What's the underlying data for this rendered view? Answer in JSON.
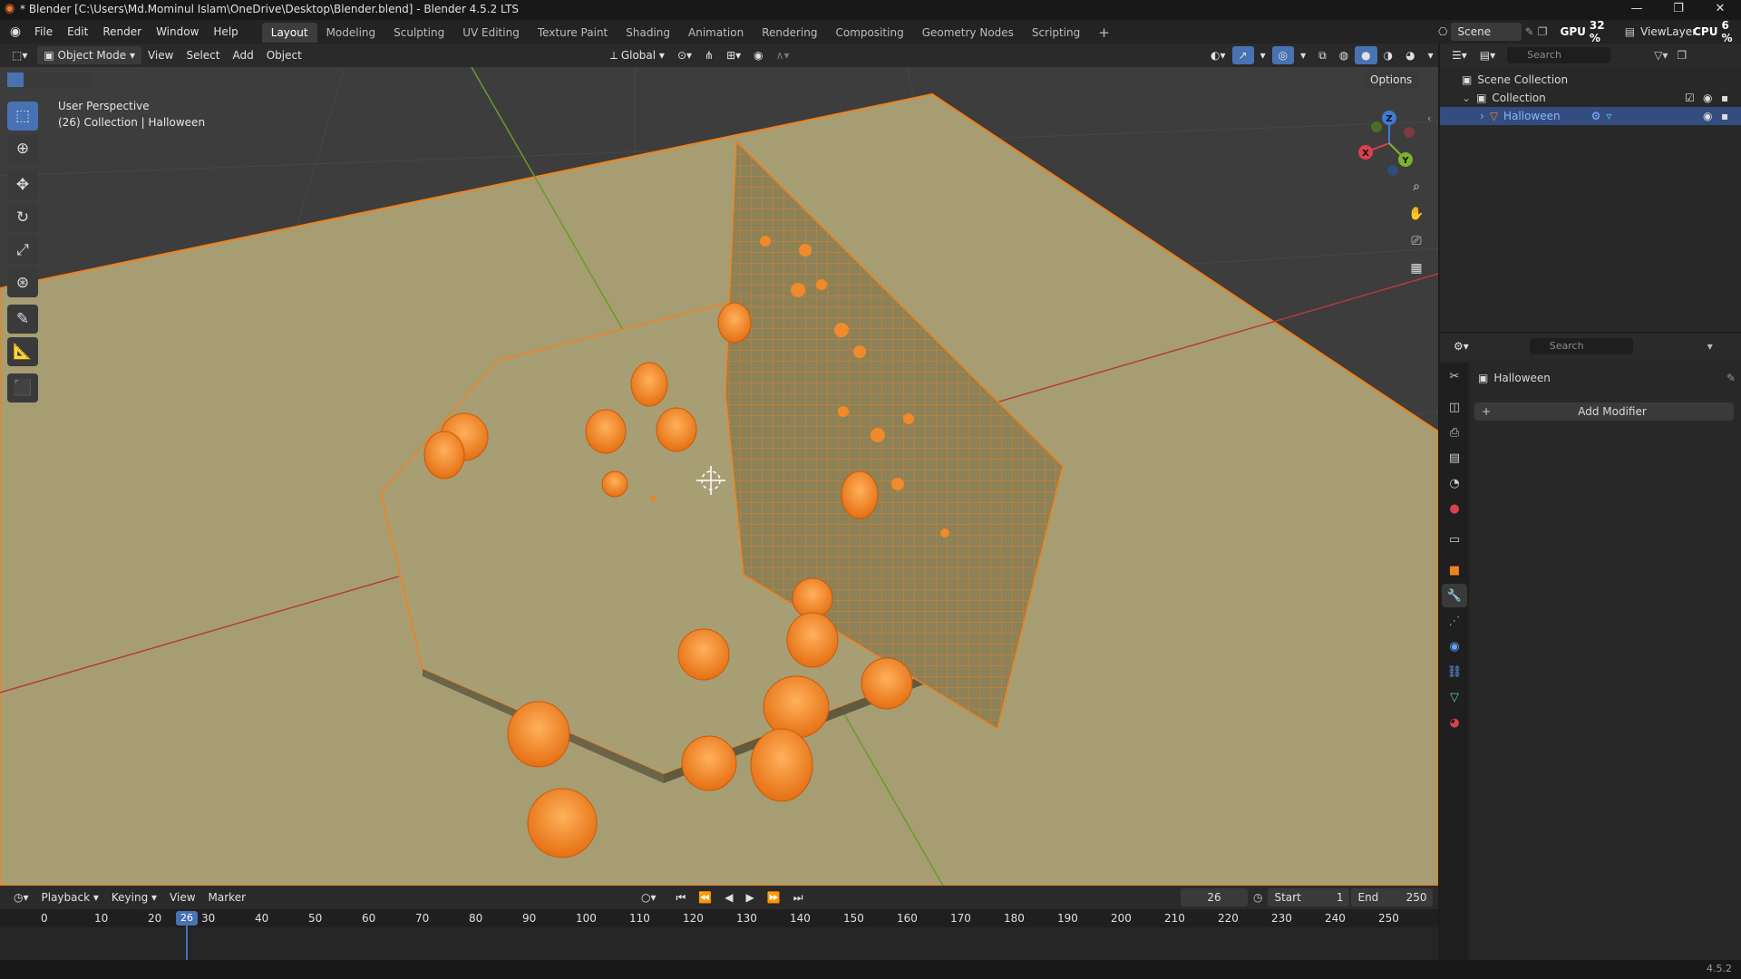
{
  "window": {
    "title": "* Blender [C:\\Users\\Md.Mominul Islam\\OneDrive\\Desktop\\Blender.blend] - Blender 4.5.2 LTS",
    "minimize": "—",
    "maximize": "❐",
    "close": "✕"
  },
  "menu": {
    "items": [
      "File",
      "Edit",
      "Render",
      "Window",
      "Help"
    ],
    "workspaces": [
      "Layout",
      "Modeling",
      "Sculpting",
      "UV Editing",
      "Texture Paint",
      "Shading",
      "Animation",
      "Rendering",
      "Compositing",
      "Geometry Nodes",
      "Scripting"
    ],
    "active_workspace": "Layout",
    "add_tab": "+",
    "scene_label": "Scene",
    "viewlayer_label": "ViewLayer",
    "gpu_label": "GPU",
    "gpu_value": "32 %",
    "cpu_label": "CPU",
    "cpu_value": "6 %"
  },
  "viewport_header": {
    "mode": "Object Mode",
    "menus": [
      "View",
      "Select",
      "Add",
      "Object"
    ],
    "transform_orientation": "Global",
    "options": "Options"
  },
  "viewport": {
    "perspective": "User Perspective",
    "collection_info": "(26) Collection | Halloween",
    "axes": {
      "x": "X",
      "y": "Y",
      "z": "Z"
    },
    "colors": {
      "background": "#3d3d3d",
      "plane": "#a79d73",
      "selection": "#f0821e",
      "x_axis": "#b53a3f",
      "y_axis": "#6b9a2a",
      "grid": "#4a4a4a"
    }
  },
  "timeline": {
    "menus": [
      "Playback",
      "Keying",
      "View",
      "Marker"
    ],
    "current_frame": "26",
    "start_label": "Start",
    "start_value": "1",
    "end_label": "End",
    "end_value": "250",
    "ticks": [
      "0",
      "10",
      "20",
      "30",
      "40",
      "50",
      "60",
      "70",
      "80",
      "90",
      "100",
      "110",
      "120",
      "130",
      "140",
      "150",
      "160",
      "170",
      "180",
      "190",
      "200",
      "210",
      "220",
      "230",
      "240",
      "250"
    ],
    "playhead_label": "26"
  },
  "outliner": {
    "search_placeholder": "Search",
    "scene_collection": "Scene Collection",
    "collection": "Collection",
    "object": "Halloween"
  },
  "properties": {
    "search_placeholder": "Search",
    "object_name": "Halloween",
    "add_modifier": "Add Modifier",
    "add_icon": "+"
  },
  "status": {
    "version": "4.5.2"
  }
}
